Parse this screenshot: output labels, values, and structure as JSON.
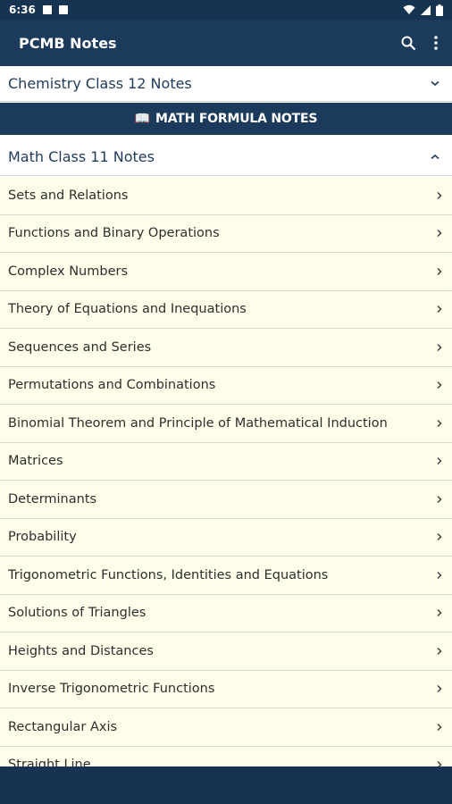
{
  "status_bar": {
    "time": "6:36"
  },
  "app_bar": {
    "title": "PCMB Notes"
  },
  "chemistry_section": {
    "title": "Chemistry Class 12 Notes"
  },
  "banner": {
    "icon": "📖",
    "label": "MATH FORMULA NOTES"
  },
  "math_section": {
    "title": "Math Class 11 Notes"
  },
  "topics": [
    "Sets and Relations",
    "Functions and Binary Operations",
    "Complex Numbers",
    "Theory of Equations and Inequations",
    "Sequences and Series",
    "Permutations and Combinations",
    "Binomial Theorem and Principle of Mathematical Induction",
    "Matrices",
    "Determinants",
    "Probability",
    "Trigonometric Functions, Identities and Equations",
    "Solutions of Triangles",
    "Heights and Distances",
    "Inverse Trigonometric Functions",
    "Rectangular Axis",
    "Straight Line"
  ],
  "colors": {
    "app_bar": "#1b3a5c",
    "status_bar": "#163352",
    "list_background": "#fdfde9",
    "header_text": "#1f3b5c"
  }
}
